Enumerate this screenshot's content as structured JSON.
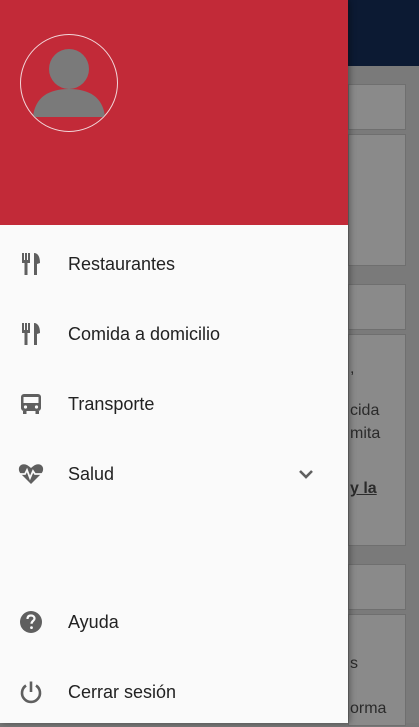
{
  "background": {
    "snippets": [
      ",",
      "cida",
      "mita",
      "y la",
      "s",
      "orma"
    ]
  },
  "drawer": {
    "header_color": "#c22a38",
    "menu": [
      {
        "label": "Restaurantes",
        "icon": "utensils-icon"
      },
      {
        "label": "Comida a domicilio",
        "icon": "utensils-icon"
      },
      {
        "label": "Transporte",
        "icon": "bus-icon"
      },
      {
        "label": "Salud",
        "icon": "heartbeat-icon",
        "expandable": true
      }
    ],
    "footer": [
      {
        "label": "Ayuda",
        "icon": "help-circle-icon"
      },
      {
        "label": "Cerrar sesión",
        "icon": "power-icon"
      }
    ]
  }
}
